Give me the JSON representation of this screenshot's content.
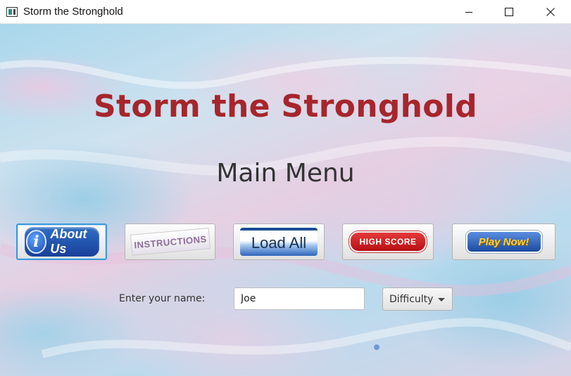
{
  "window": {
    "title": "Storm the Stronghold",
    "controls": [
      "minimize",
      "maximize",
      "close"
    ]
  },
  "main": {
    "game_title": "Storm the Stronghold",
    "subtitle": "Main Menu",
    "title_color": "#a6262c"
  },
  "buttons": {
    "about": "About Us",
    "instructions": "INSTRUCTIONS",
    "load": "Load All",
    "high_score": "HIGH SCORE",
    "play": "Play Now!"
  },
  "form": {
    "name_label": "Enter your name:",
    "name_value": "Joe",
    "difficulty_label": "Difficulty"
  }
}
